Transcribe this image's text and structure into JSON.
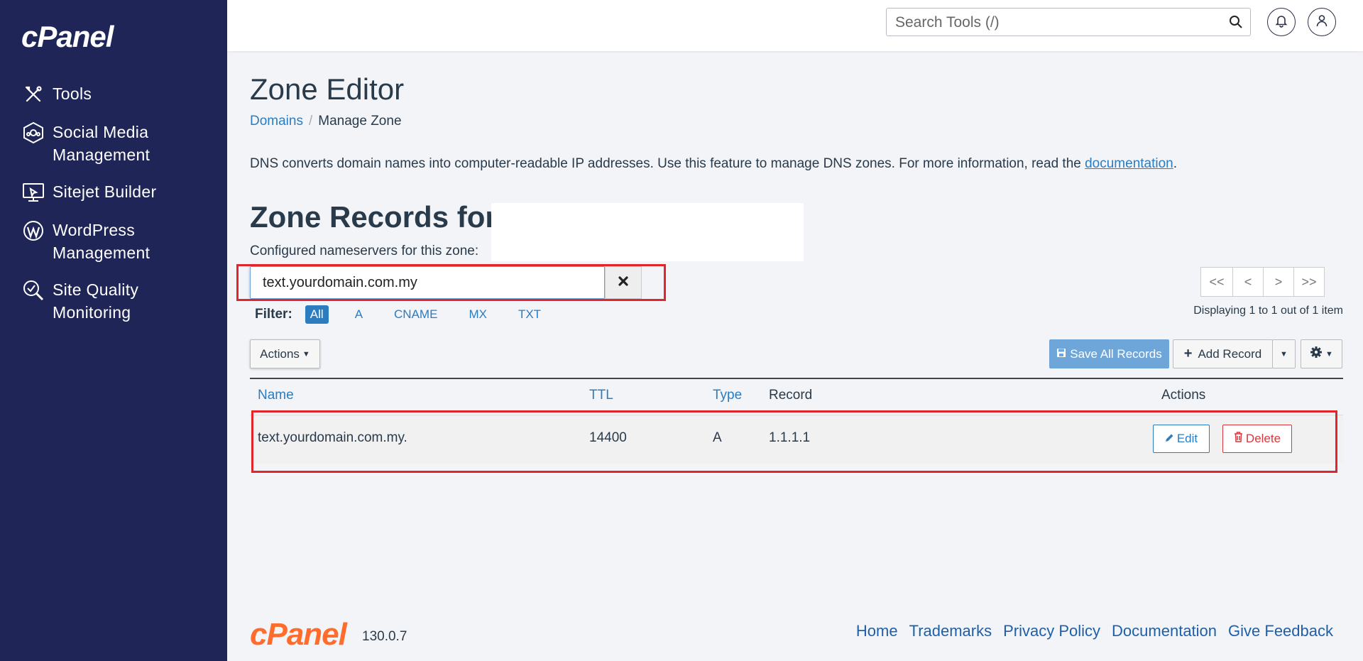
{
  "brand": {
    "logo_text": "cPanel",
    "footer_logo_text": "cPanel",
    "version": "130.0.7"
  },
  "sidebar": {
    "items": [
      {
        "label": "Tools",
        "icon": "tools-icon"
      },
      {
        "label": "Social Media Management",
        "icon": "social-media-icon"
      },
      {
        "label": "Sitejet Builder",
        "icon": "sitejet-icon"
      },
      {
        "label": "WordPress Management",
        "icon": "wordpress-icon"
      },
      {
        "label": "Site Quality Monitoring",
        "icon": "site-quality-icon"
      }
    ]
  },
  "topbar": {
    "search_placeholder": "Search Tools (/)"
  },
  "page": {
    "title": "Zone Editor",
    "breadcrumb": {
      "parent": "Domains",
      "current": "Manage Zone"
    },
    "description": "DNS converts domain names into computer-readable IP addresses. Use this feature to manage DNS zones. For more information, read the ",
    "description_link": "documentation",
    "description_end": ".",
    "zone_title": "Zone Records for ‘",
    "nameservers_label": "Configured nameservers for this zone:"
  },
  "search": {
    "value": "text.yourdomain.com.my"
  },
  "filter": {
    "label": "Filter:",
    "options": [
      "All",
      "A",
      "CNAME",
      "MX",
      "TXT"
    ],
    "active": "All"
  },
  "pagination": {
    "first": "<<",
    "prev": "<",
    "next": ">",
    "last": ">>",
    "displaying": "Displaying 1 to 1 out of 1 item"
  },
  "toolbar": {
    "actions_label": "Actions",
    "save_label": "Save All Records",
    "add_label": "Add Record"
  },
  "table": {
    "headers": {
      "name": "Name",
      "ttl": "TTL",
      "type": "Type",
      "record": "Record",
      "actions": "Actions"
    },
    "rows": [
      {
        "name": "text.yourdomain.com.my.",
        "ttl": "14400",
        "type": "A",
        "record": "1.1.1.1",
        "edit": "Edit",
        "delete": "Delete"
      }
    ]
  },
  "footer": {
    "links": [
      "Home",
      "Trademarks",
      "Privacy Policy",
      "Documentation",
      "Give Feedback"
    ]
  },
  "colors": {
    "sidebar_bg": "#1f2556",
    "link": "#2c7cc0",
    "highlight": "#e0262c",
    "logo_orange": "#ff6c2c"
  }
}
